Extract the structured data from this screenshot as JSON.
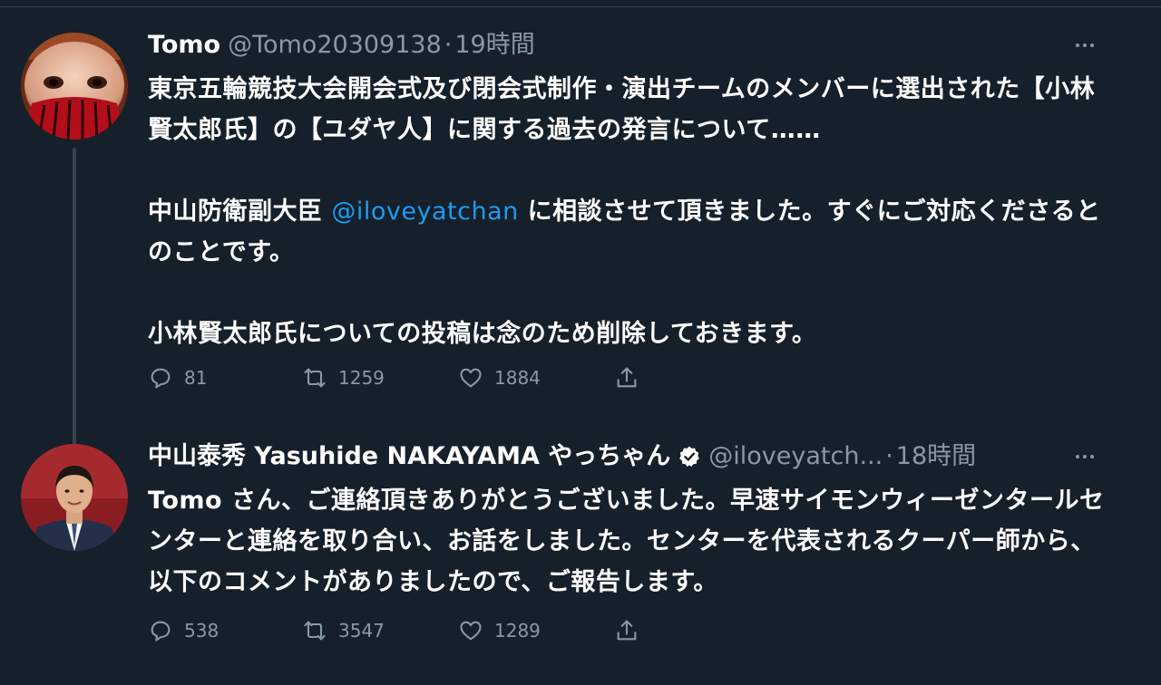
{
  "tweets": [
    {
      "display_name": "Tomo",
      "handle": "@Tomo20309138",
      "separator": "·",
      "time": "19時間",
      "body": {
        "p1": "東京五輪競技大会開会式及び閉会式制作・演出チームのメンバーに選出された【小林賢太郎氏】の【ユダヤ人】に関する過去の発言について……",
        "p2_before": "中山防衛副大臣 ",
        "p2_mention": "@iloveyatchan",
        "p2_after": " に相談させて頂きました。すぐにご対応くださるとのことです。",
        "p3": "小林賢太郎氏についての投稿は念のため削除しておきます。"
      },
      "stats": {
        "replies": "81",
        "retweets": "1259",
        "likes": "1884"
      }
    },
    {
      "display_name": "中山泰秀 Yasuhide NAKAYAMA やっちゃん",
      "handle": "@iloveyatch...",
      "separator": "·",
      "time": "18時間",
      "body": {
        "p1": "Tomo さん、ご連絡頂きありがとうございました。早速サイモンウィーゼンタールセンターと連絡を取り合い、お話をしました。センターを代表されるクーパー師から、以下のコメントがありましたので、ご報告します。"
      },
      "stats": {
        "replies": "538",
        "retweets": "3547",
        "likes": "1289"
      }
    }
  ],
  "icons": {
    "reply": "reply-icon",
    "retweet": "retweet-icon",
    "like": "heart-icon",
    "share": "share-icon",
    "more": "more-icon",
    "verified": "verified-badge-icon"
  },
  "colors": {
    "background": "#15202b",
    "secondary_text": "#8899a6",
    "link": "#1d9bf0",
    "divider": "#38444d"
  }
}
